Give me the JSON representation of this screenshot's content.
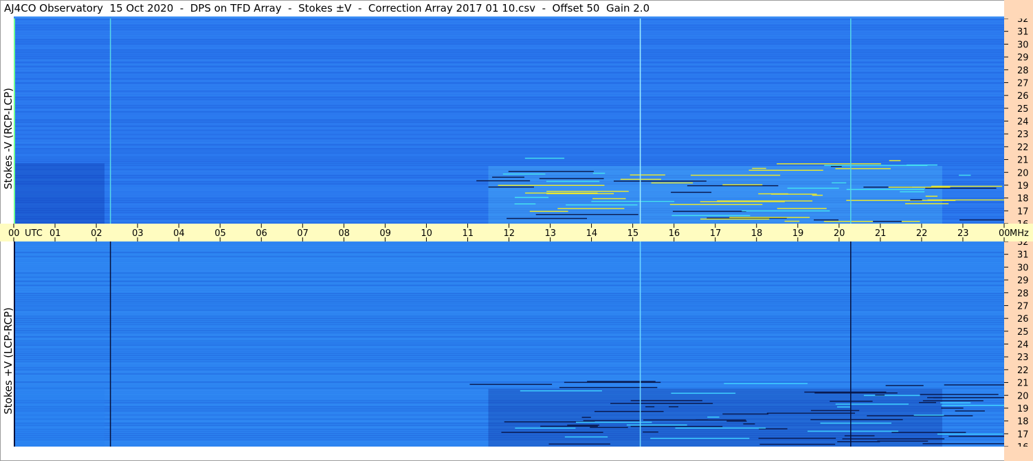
{
  "title": "AJ4CO Observatory  15 Oct 2020  -  DPS on TFD Array  -  Stokes ±V  -  Correction Array 2017 01 10.csv  -  Offset 50  Gain 2.0",
  "colors": {
    "time_band": "#fffcc0",
    "freq_band": "#ffd8b8",
    "top_background": "#2a78ee",
    "bottom_background": "#2c83f0",
    "hot_pixels": "#e8e830",
    "dark_stripes": "#0a1a50"
  },
  "chart_data": {
    "type": "heatmap",
    "colormap": "blue-cyan-yellow",
    "x_axis": {
      "label": "UTC",
      "unit": "UTC",
      "range": [
        0,
        24
      ],
      "ticks": [
        "00",
        "01",
        "02",
        "03",
        "04",
        "05",
        "06",
        "07",
        "08",
        "09",
        "10",
        "11",
        "12",
        "13",
        "14",
        "15",
        "16",
        "17",
        "18",
        "19",
        "20",
        "21",
        "22",
        "23",
        "00"
      ]
    },
    "y_axis": {
      "unit": "MHz",
      "range": [
        16,
        32
      ],
      "ticks": [
        "16",
        "17",
        "18",
        "19",
        "20",
        "21",
        "22",
        "23",
        "24",
        "25",
        "26",
        "27",
        "28",
        "29",
        "30",
        "31",
        "32"
      ]
    },
    "panels": [
      {
        "name": "Stokes -V (RCP-LCP)",
        "position": "top"
      },
      {
        "name": "Stokes +V (LCP-RCP)",
        "position": "bottom"
      }
    ],
    "vertical_events_utc": [
      2.33,
      15.17,
      20.27
    ]
  }
}
